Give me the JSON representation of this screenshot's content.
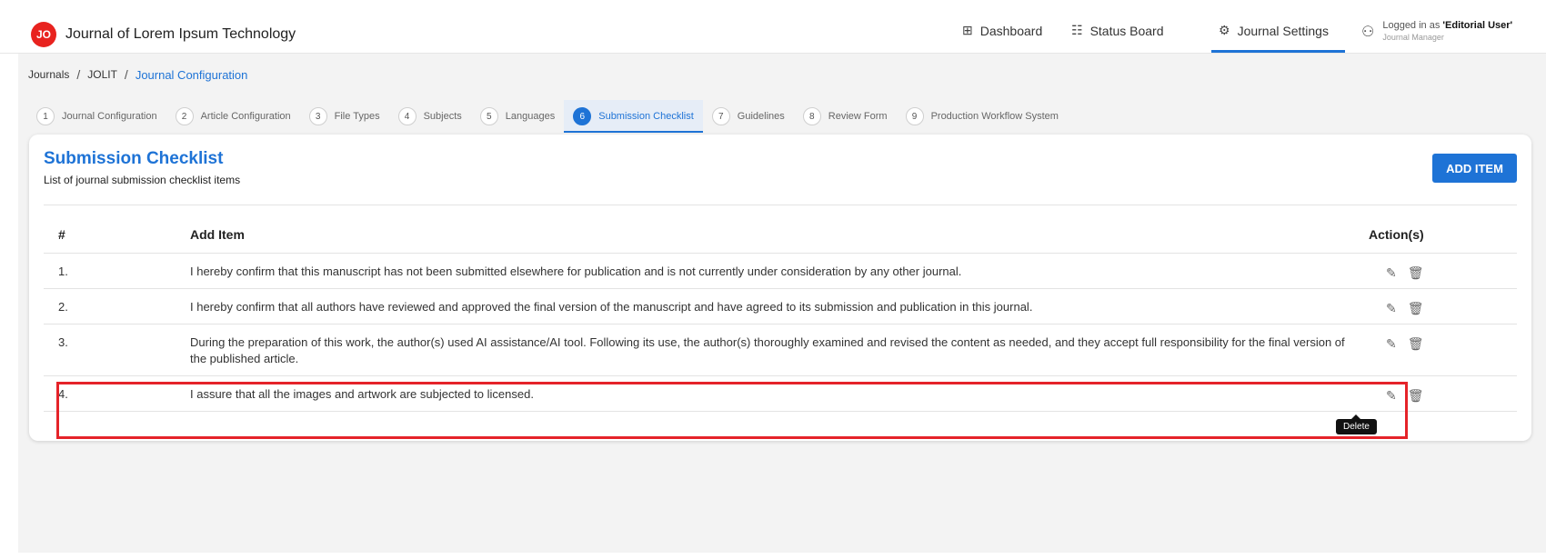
{
  "header": {
    "logo_initials": "JO",
    "journal_title": "Journal of Lorem Ipsum Technology",
    "nav": {
      "dashboard": "Dashboard",
      "status_board": "Status Board",
      "journal_settings": "Journal Settings"
    },
    "user": {
      "prefix": "Logged in as ",
      "name": "'Editorial User'",
      "role": "Journal Manager"
    }
  },
  "breadcrumb": {
    "journals": "Journals",
    "journal_code": "JOLIT",
    "current": "Journal Configuration",
    "separator": "/"
  },
  "steps": [
    {
      "num": "1",
      "label": "Journal Configuration"
    },
    {
      "num": "2",
      "label": "Article Configuration"
    },
    {
      "num": "3",
      "label": "File Types"
    },
    {
      "num": "4",
      "label": "Subjects"
    },
    {
      "num": "5",
      "label": "Languages"
    },
    {
      "num": "6",
      "label": "Submission Checklist"
    },
    {
      "num": "7",
      "label": "Guidelines"
    },
    {
      "num": "8",
      "label": "Review Form"
    },
    {
      "num": "9",
      "label": "Production Workflow System"
    }
  ],
  "active_step": "6",
  "card": {
    "title": "Submission Checklist",
    "subtitle": "List of journal submission checklist items",
    "add_button": "ADD ITEM"
  },
  "table": {
    "headers": {
      "num": "#",
      "item": "Add Item",
      "actions": "Action(s)"
    },
    "rows": [
      {
        "num": "1.",
        "text": "I hereby confirm that this manuscript has not been submitted elsewhere for publication and is not currently under consideration by any other journal."
      },
      {
        "num": "2.",
        "text": "I hereby confirm that all authors have reviewed and approved the final version of the manuscript and have agreed to its submission and publication in this journal."
      },
      {
        "num": "3.",
        "text": "During the preparation of this work, the author(s) used AI assistance/AI tool. Following its use, the author(s) thoroughly examined and revised the content as needed, and they accept full responsibility for the final version of the published article."
      },
      {
        "num": "4.",
        "text": "I assure that all the images and artwork are subjected to licensed."
      }
    ]
  },
  "tooltip": "Delete",
  "colors": {
    "accent": "#1e73d6",
    "highlight": "#e52329",
    "logo": "#e8231f"
  }
}
